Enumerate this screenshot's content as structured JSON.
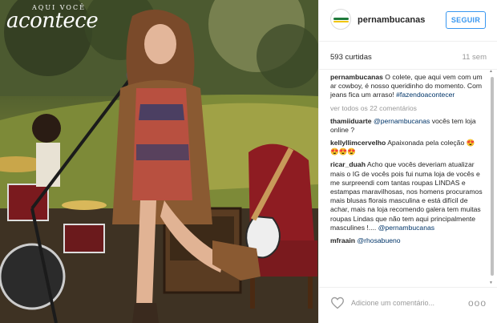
{
  "photo": {
    "watermark_small": "AQUI VOCÊ",
    "watermark_big": "acontece"
  },
  "header": {
    "username": "pernambucanas",
    "follow_label": "SEGUIR"
  },
  "stats": {
    "likes": "593 curtidas",
    "time": "11 sem"
  },
  "caption": {
    "user": "pernambucanas",
    "text": " O colete, que aqui vem com um ar cowboy, é nosso queridinho do momento. Com jeans fica um arraso! ",
    "hashtag": "#fazendoacontecer"
  },
  "view_all": "ver todos os 22 comentários",
  "comments": [
    {
      "user": "thamiiduarte",
      "mention": "@pernambucanas",
      "text": " vocês tem loja online ?"
    },
    {
      "user": "kellyllimcervelho",
      "mention": "",
      "text": " Apaixonada pela coleção 😍😍😍😍"
    },
    {
      "user": "ricar_duah",
      "mention": "@pernambucanas",
      "text": " Acho que vocês deveriam atualizar mais o IG de vocês pois fui numa loja de vocês e me surpreendi com tantas roupas LINDAS e estampas maravilhosas, nos homens procuramos mais blusas florais masculina e está difícil de achar, mais na loja recomendo galera tem muitas roupas Lindas que não tem aqui principalmente masculines !.... "
    },
    {
      "user": "mfraain",
      "mention": "@rhosabueno",
      "text": ""
    }
  ],
  "footer": {
    "comment_placeholder": "Adicione um comentário...",
    "more_label": "ooo"
  },
  "colors": {
    "link": "#003569",
    "accent": "#3897f0",
    "muted": "#999999"
  }
}
